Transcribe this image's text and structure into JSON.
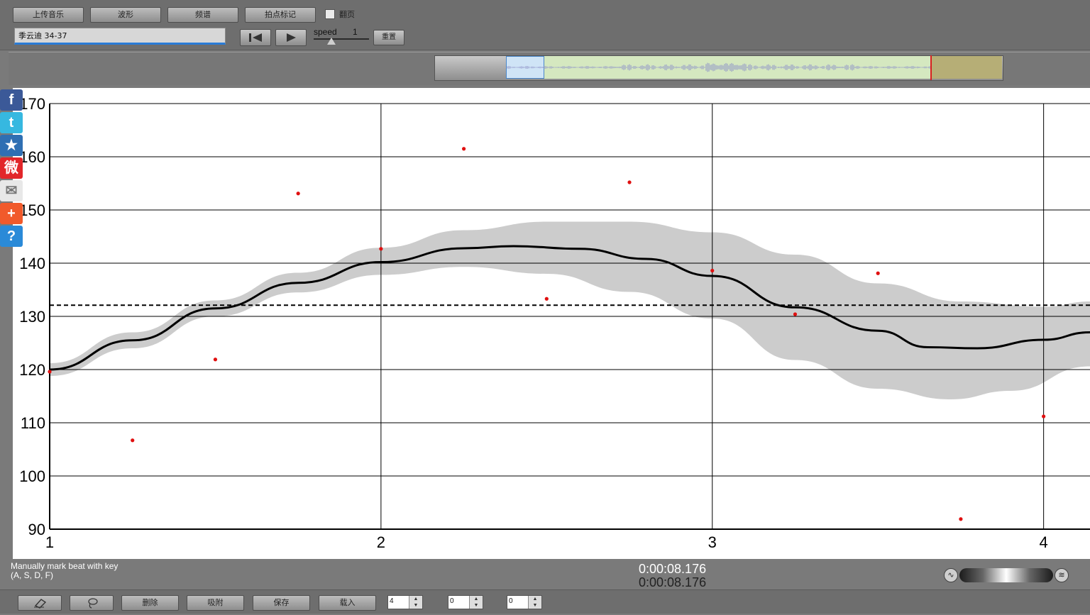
{
  "toolbar": {
    "upload_label": "上传音乐",
    "waveform_label": "波形",
    "spectrum_label": "频谱",
    "beatmark_label": "拍点标记",
    "page_flip_label": "翻页",
    "track_title": "季云迪 34-37",
    "speed_label": "speed",
    "speed_value": "1",
    "reset_label": "重置"
  },
  "status": {
    "hint_line1": "Manually mark beat with key",
    "hint_line2": "(A, S, D, F)",
    "time_current": "0:00:08.176",
    "time_total": "0:00:08.176"
  },
  "bottom": {
    "erase_icon": "eraser-icon",
    "lasso_icon": "lasso-icon",
    "delete_label": "删除",
    "snap_label": "吸附",
    "save_label": "保存",
    "load_label": "载入",
    "spin1": "4",
    "spin2": "0",
    "spin3": "0"
  },
  "share": [
    {
      "name": "facebook-icon",
      "glyph": "f",
      "color": "#3b5998"
    },
    {
      "name": "twitter-icon",
      "glyph": "t",
      "color": "#36b8e0"
    },
    {
      "name": "favorite-star-icon",
      "glyph": "★",
      "color": "#2f6fb3"
    },
    {
      "name": "weibo-icon",
      "glyph": "微",
      "color": "#e2262a"
    },
    {
      "name": "email-icon",
      "glyph": "✉",
      "color": "#e8e8e8"
    },
    {
      "name": "add-share-icon",
      "glyph": "+",
      "color": "#f15a2b"
    },
    {
      "name": "help-icon",
      "glyph": "?",
      "color": "#2a8ad8"
    }
  ],
  "colors": {
    "points": "#e01010",
    "curve": "#000000",
    "band": "#cccccc",
    "mean_line": "#000000"
  },
  "chart_data": {
    "type": "scatter",
    "xlim": [
      1,
      4.14
    ],
    "ylim": [
      90,
      170
    ],
    "x_ticks": [
      1,
      2,
      3,
      4
    ],
    "y_ticks": [
      90,
      100,
      110,
      120,
      130,
      140,
      150,
      160,
      170
    ],
    "grid": true,
    "points": [
      {
        "x": 1.0,
        "y": 119.6
      },
      {
        "x": 1.25,
        "y": 106.7
      },
      {
        "x": 1.5,
        "y": 121.9
      },
      {
        "x": 1.75,
        "y": 153.1
      },
      {
        "x": 2.0,
        "y": 142.7
      },
      {
        "x": 2.25,
        "y": 161.5
      },
      {
        "x": 2.5,
        "y": 133.3
      },
      {
        "x": 2.75,
        "y": 155.2
      },
      {
        "x": 3.0,
        "y": 138.6
      },
      {
        "x": 3.25,
        "y": 130.4
      },
      {
        "x": 3.5,
        "y": 138.1
      },
      {
        "x": 3.75,
        "y": 91.9
      },
      {
        "x": 4.0,
        "y": 111.2
      }
    ],
    "mean_line": 132.1,
    "curve": [
      {
        "x": 1.0,
        "y": 120.0
      },
      {
        "x": 1.25,
        "y": 125.5
      },
      {
        "x": 1.5,
        "y": 131.5
      },
      {
        "x": 1.75,
        "y": 136.3
      },
      {
        "x": 2.0,
        "y": 140.2
      },
      {
        "x": 2.25,
        "y": 142.8
      },
      {
        "x": 2.4,
        "y": 143.2
      },
      {
        "x": 2.6,
        "y": 142.7
      },
      {
        "x": 2.8,
        "y": 140.8
      },
      {
        "x": 3.0,
        "y": 137.6
      },
      {
        "x": 3.25,
        "y": 131.7
      },
      {
        "x": 3.5,
        "y": 127.3
      },
      {
        "x": 3.65,
        "y": 124.2
      },
      {
        "x": 3.8,
        "y": 124.0
      },
      {
        "x": 4.0,
        "y": 125.6
      },
      {
        "x": 4.14,
        "y": 127.0
      }
    ],
    "band_upper": [
      {
        "x": 1.0,
        "y": 121.2
      },
      {
        "x": 1.25,
        "y": 127.0
      },
      {
        "x": 1.5,
        "y": 133.0
      },
      {
        "x": 1.75,
        "y": 138.2
      },
      {
        "x": 2.0,
        "y": 142.9
      },
      {
        "x": 2.25,
        "y": 146.2
      },
      {
        "x": 2.5,
        "y": 147.8
      },
      {
        "x": 2.75,
        "y": 147.8
      },
      {
        "x": 3.0,
        "y": 145.8
      },
      {
        "x": 3.25,
        "y": 141.6
      },
      {
        "x": 3.5,
        "y": 136.2
      },
      {
        "x": 3.75,
        "y": 132.8
      },
      {
        "x": 4.0,
        "y": 131.8
      },
      {
        "x": 4.14,
        "y": 132.8
      }
    ],
    "band_lower": [
      {
        "x": 1.0,
        "y": 118.8
      },
      {
        "x": 1.25,
        "y": 124.0
      },
      {
        "x": 1.5,
        "y": 130.0
      },
      {
        "x": 1.75,
        "y": 134.5
      },
      {
        "x": 2.0,
        "y": 137.8
      },
      {
        "x": 2.25,
        "y": 139.3
      },
      {
        "x": 2.5,
        "y": 138.0
      },
      {
        "x": 2.75,
        "y": 134.6
      },
      {
        "x": 3.0,
        "y": 129.6
      },
      {
        "x": 3.25,
        "y": 121.8
      },
      {
        "x": 3.5,
        "y": 116.4
      },
      {
        "x": 3.72,
        "y": 114.4
      },
      {
        "x": 3.9,
        "y": 116.0
      },
      {
        "x": 4.14,
        "y": 120.6
      }
    ]
  }
}
